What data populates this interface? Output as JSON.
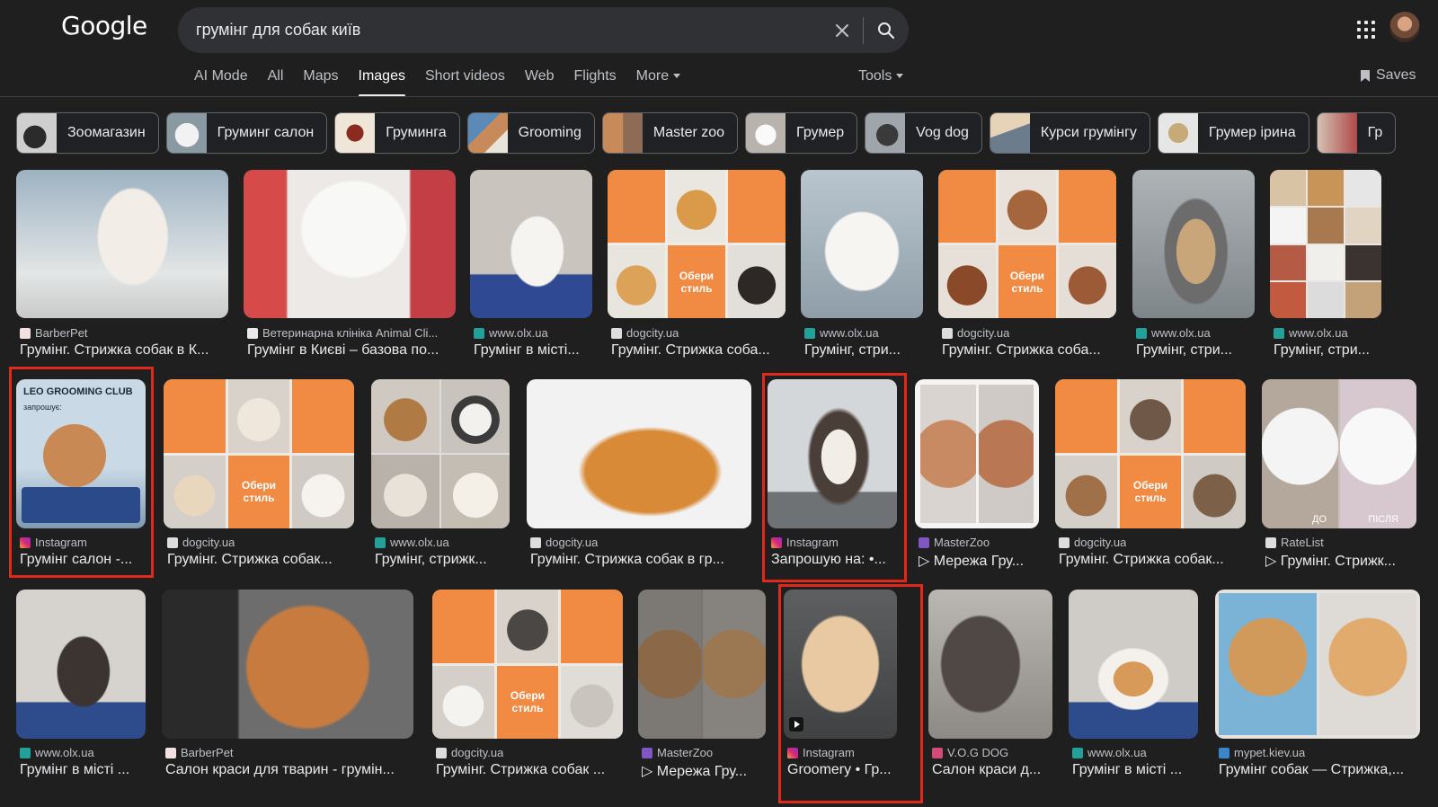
{
  "logo": "Google",
  "search": {
    "value": "грумінг для собак київ"
  },
  "tabs": [
    "AI Mode",
    "All",
    "Maps",
    "Images",
    "Short videos",
    "Web",
    "Flights",
    "More"
  ],
  "tools_label": "Tools",
  "saves_label": "Saves",
  "chips": [
    "Зоомагазин",
    "Груминг салон",
    "Груминга",
    "Grooming",
    "Master zoo",
    "Грумер",
    "Vog dog",
    "Курси грумінгу",
    "Грумер ірина",
    "Гр"
  ],
  "results": [
    {
      "source": "BarberPet",
      "title": "Грумінг. Стрижка собак в К..."
    },
    {
      "source": "Ветеринарна клініка Animal Cli...",
      "title": "Грумінг в Києві – базова по..."
    },
    {
      "source": "www.olx.ua",
      "title": "Грумінг в місті..."
    },
    {
      "source": "dogcity.ua",
      "title": "Грумінг. Стрижка соба..."
    },
    {
      "source": "www.olx.ua",
      "title": "Грумінг, стри..."
    },
    {
      "source": "dogcity.ua",
      "title": "Грумінг. Стрижка соба..."
    },
    {
      "source": "www.olx.ua",
      "title": "Грумінг, стри..."
    },
    {
      "source": "www.olx.ua",
      "title": "Грумінг, стри..."
    },
    {
      "source": "Instagram",
      "title": "Грумінг салон -..."
    },
    {
      "source": "dogcity.ua",
      "title": "Грумінг. Стрижка собак..."
    },
    {
      "source": "www.olx.ua",
      "title": "Грумінг, стрижк..."
    },
    {
      "source": "dogcity.ua",
      "title": "Грумінг. Стрижка собак в гр..."
    },
    {
      "source": "Instagram",
      "title": "Запрошую на: •..."
    },
    {
      "source": "MasterZoo",
      "title": "▷ Мережа Гру..."
    },
    {
      "source": "dogcity.ua",
      "title": "Грумінг. Стрижка собак..."
    },
    {
      "source": "RateList",
      "title": "▷ Грумінг. Стрижк..."
    },
    {
      "source": "www.olx.ua",
      "title": "Грумінг в місті ..."
    },
    {
      "source": "BarberPet",
      "title": "Салон краси для тварин - грумін..."
    },
    {
      "source": "dogcity.ua",
      "title": "Грумінг. Стрижка собак ..."
    },
    {
      "source": "MasterZoo",
      "title": "▷ Мережа Гру..."
    },
    {
      "source": "Instagram",
      "title": "Groomery • Гр..."
    },
    {
      "source": "V.O.G DOG",
      "title": "Салон краси д..."
    },
    {
      "source": "www.olx.ua",
      "title": "Грумінг в місті ..."
    },
    {
      "source": "mypet.kiev.ua",
      "title": "Грумінг собак — Стрижка,..."
    }
  ],
  "image_captions": {
    "leo_brand": "LEO GROOMING CLUB",
    "leo_sub": "запрошує:",
    "oberi": "Обери стиль",
    "do": "ДО",
    "pislya": "ПІСЛЯ"
  },
  "colors": {
    "background": "#1f1f1f",
    "highlight": "#e0281b",
    "dogcity_orange": "#f18a42"
  }
}
